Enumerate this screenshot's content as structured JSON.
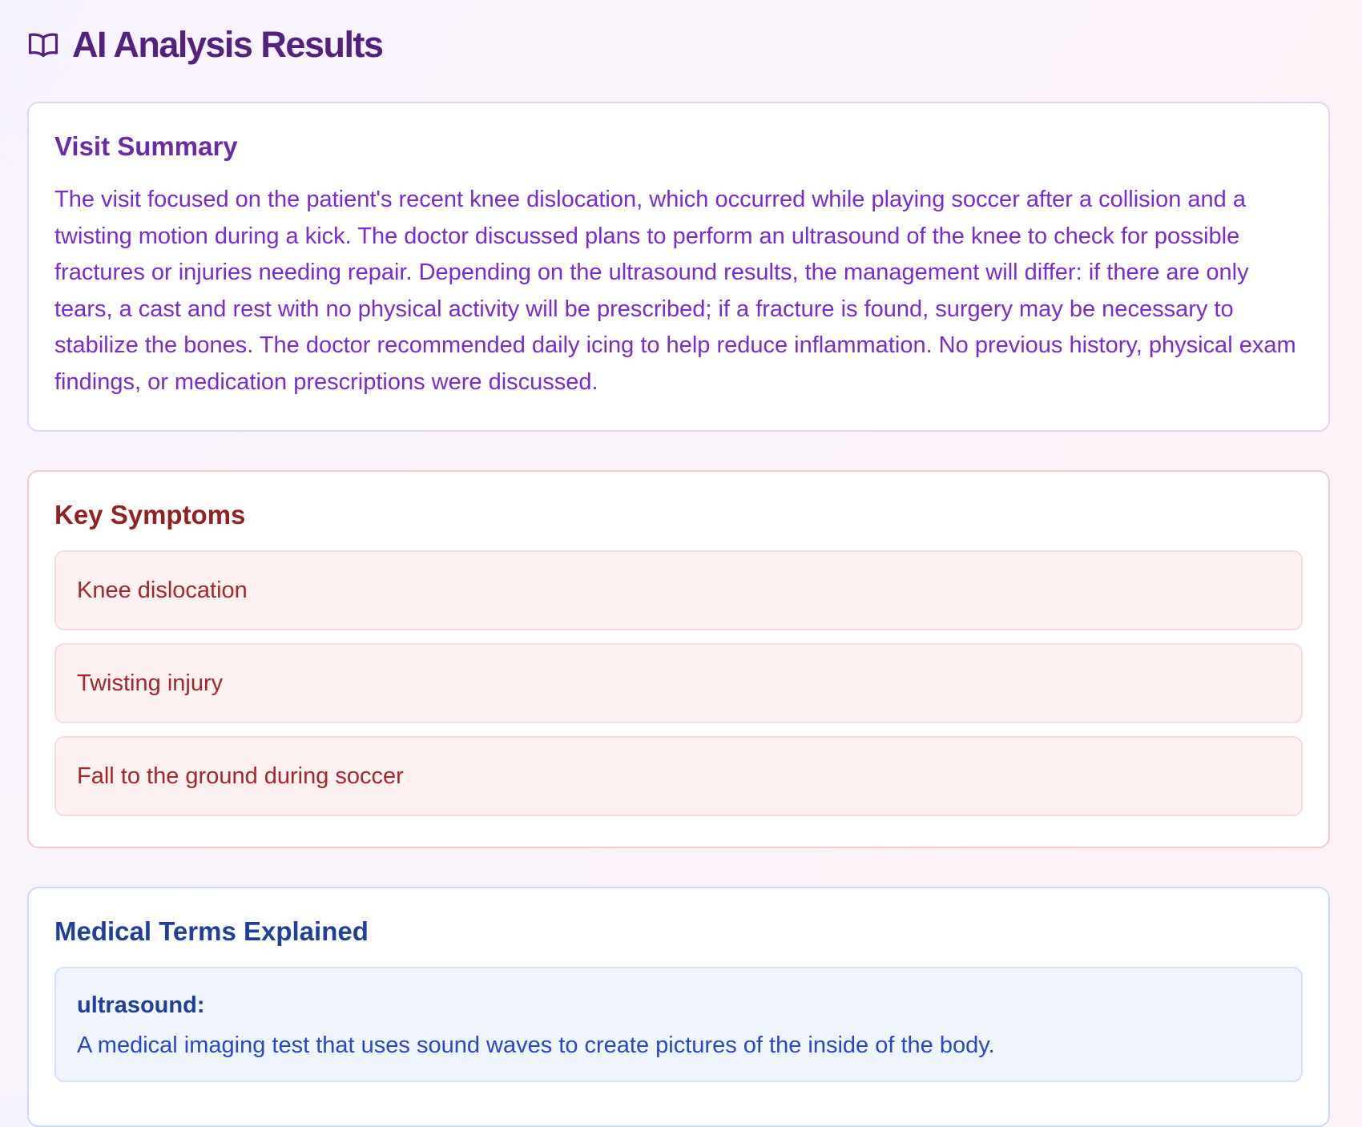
{
  "header": {
    "title": "AI Analysis Results",
    "icon": "book-open-icon"
  },
  "summary": {
    "title": "Visit Summary",
    "text": "The visit focused on the patient's recent knee dislocation, which occurred while playing soccer after a collision and a twisting motion during a kick. The doctor discussed plans to perform an ultrasound of the knee to check for possible fractures or injuries needing repair. Depending on the ultrasound results, the management will differ: if there are only tears, a cast and rest with no physical activity will be prescribed; if a fracture is found, surgery may be necessary to stabilize the bones. The doctor recommended daily icing to help reduce inflammation. No previous history, physical exam findings, or medication prescriptions were discussed."
  },
  "symptoms": {
    "title": "Key Symptoms",
    "items": [
      {
        "label": "Knee dislocation"
      },
      {
        "label": "Twisting injury"
      },
      {
        "label": "Fall to the ground during soccer"
      }
    ]
  },
  "terms": {
    "title": "Medical Terms Explained",
    "items": [
      {
        "term": "ultrasound:",
        "definition": "A medical imaging test that uses sound waves to create pictures of the inside of the body."
      }
    ]
  },
  "colors": {
    "summary_accent": "#7a2ad0",
    "symptoms_accent": "#a4262b",
    "terms_accent": "#2747c4"
  }
}
